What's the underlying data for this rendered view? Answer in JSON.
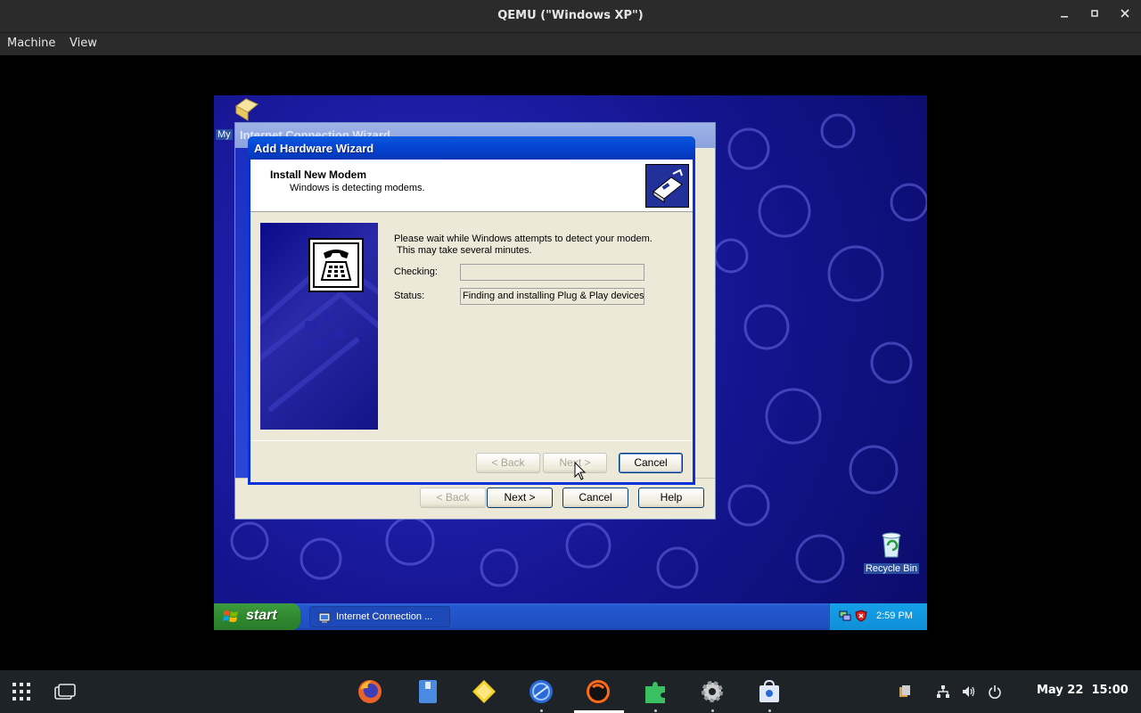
{
  "qemu": {
    "title": "QEMU (\"Windows XP\")",
    "menu": [
      "Machine",
      "View"
    ]
  },
  "xp": {
    "desktop_icon_my_label": "My",
    "recycle_bin_label": "Recycle Bin",
    "bg_wizard": {
      "title": "Internet Connection Wizard",
      "buttons": {
        "back": "< Back",
        "next": "Next >",
        "cancel": "Cancel",
        "help": "Help"
      }
    },
    "dialog": {
      "title": "Add Hardware Wizard",
      "header_title": "Install New Modem",
      "header_subtitle": "Windows is detecting modems.",
      "line1": "Please wait while Windows attempts to detect your modem.",
      "line2": "This may take several minutes.",
      "checking_label": "Checking:",
      "checking_value": "",
      "status_label": "Status:",
      "status_value": "Finding and installing Plug & Play devices.",
      "buttons": {
        "back": "< Back",
        "next": "Next >",
        "cancel": "Cancel"
      }
    },
    "taskbar": {
      "start_label": "start",
      "task_label": "Internet Connection ...",
      "clock": "2:59 PM"
    }
  },
  "dock": {
    "date": "May 22",
    "time": "15:00",
    "apps": [
      "firefox-icon",
      "files-icon",
      "notes-icon",
      "browser-icon",
      "qemu-icon",
      "puzzle-icon",
      "settings-icon",
      "software-icon"
    ]
  }
}
